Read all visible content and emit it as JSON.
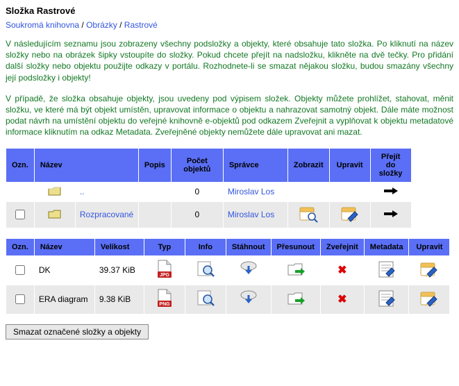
{
  "title": "Složka Rastrové",
  "breadcrumbs": [
    {
      "label": "Soukromá knihovna",
      "sep": " / "
    },
    {
      "label": "Obrázky",
      "sep": " / "
    },
    {
      "label": "Rastrové",
      "sep": ""
    }
  ],
  "description1": "V následujícím seznamu jsou zobrazeny všechny podsložky a objekty, které obsahuje tato složka. Po kliknutí na název složky nebo na obrázek šipky vstoupíte do složky. Pokud chcete přejít na nadsložku, klikněte na dvě tečky. Pro přidání další složky nebo objektu použijte odkazy v portálu. Rozhodnete-li se smazat nějakou složku, budou smazány všechny její podsložky i objekty!",
  "description2": "V případě, že složka obsahuje objekty, jsou uvedeny pod výpisem složek. Objekty můžete prohlížet, stahovat, měnit složku, ve které má být objekt umístěn, upravovat informace o objektu a nahrazovat samotný objekt. Dále máte možnost podat návrh na umístění objektu do veřejné knihovně e-objektů pod odkazem Zveřejnit a vyplňovat k objektu metadatové informace kliknutím na odkaz Metadata. Zveřejněné objekty nemůžete dále upravovat ani mazat.",
  "folders": {
    "headers": {
      "mark": "Ozn.",
      "name": "Název",
      "desc": "Popis",
      "count": "Počet objektů",
      "admin": "Správce",
      "view": "Zobrazit",
      "edit": "Upravit",
      "go": "Přejít do složky"
    },
    "rows": [
      {
        "checkbox": false,
        "name": "..",
        "desc": "",
        "count": "0",
        "admin": "Miroslav Los",
        "hasActions": false,
        "alt": true
      },
      {
        "checkbox": true,
        "name": "Rozpracované",
        "desc": "",
        "count": "0",
        "admin": "Miroslav Los",
        "hasActions": true,
        "alt": false
      }
    ]
  },
  "objects": {
    "headers": {
      "mark": "Ozn.",
      "name": "Název",
      "size": "Velikost",
      "type": "Typ",
      "info": "Info",
      "download": "Stáhnout",
      "move": "Přesunout",
      "publish": "Zveřejnit",
      "metadata": "Metadata",
      "edit": "Upravit"
    },
    "rows": [
      {
        "name": "DK",
        "size": "39.37 KiB",
        "type": "JPG",
        "published": false,
        "alt": true
      },
      {
        "name": "ERA diagram",
        "size": "9.38 KiB",
        "type": "PNG",
        "published": false,
        "alt": false
      }
    ]
  },
  "deleteButton": "Smazat označené složky a objekty"
}
